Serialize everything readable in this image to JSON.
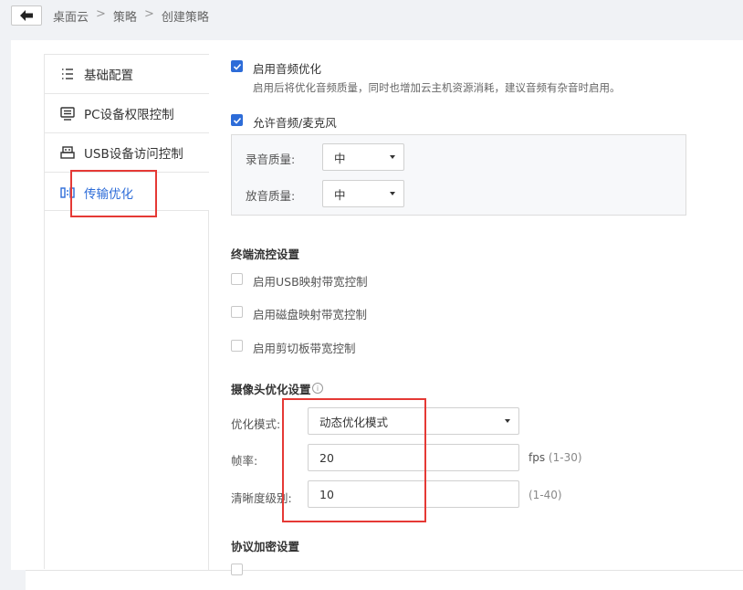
{
  "breadcrumb": {
    "items": [
      "桌面云",
      "策略",
      "创建策略"
    ],
    "separator": ">"
  },
  "sidebar": {
    "items": [
      {
        "label": "基础配置",
        "icon": "list-icon",
        "active": false
      },
      {
        "label": "PC设备权限控制",
        "icon": "monitor-icon",
        "active": false
      },
      {
        "label": "USB设备访问控制",
        "icon": "usb-icon",
        "active": false
      },
      {
        "label": "传输优化",
        "icon": "transfer-icon",
        "active": true
      }
    ]
  },
  "audio": {
    "enable_opt_label": "启用音频优化",
    "enable_opt_checked": true,
    "enable_opt_desc": "启用后将优化音频质量，同时也增加云主机资源消耗，建议音频有杂音时启用。",
    "allow_mic_label": "允许音频/麦克风",
    "allow_mic_checked": true,
    "record_quality_label": "录音质量:",
    "record_quality_value": "中",
    "playback_quality_label": "放音质量:",
    "playback_quality_value": "中"
  },
  "flow_control": {
    "title": "终端流控设置",
    "items": [
      {
        "label": "启用USB映射带宽控制",
        "checked": false
      },
      {
        "label": "启用磁盘映射带宽控制",
        "checked": false
      },
      {
        "label": "启用剪切板带宽控制",
        "checked": false
      }
    ]
  },
  "camera": {
    "title": "摄像头优化设置",
    "mode_label": "优化模式:",
    "mode_value": "动态优化模式",
    "fps_label": "帧率:",
    "fps_value": "20",
    "fps_unit": "fps",
    "fps_range": "(1-30)",
    "clarity_label": "清晰度级别:",
    "clarity_value": "10",
    "clarity_range": "(1-40)"
  },
  "encryption": {
    "title": "协议加密设置"
  },
  "colors": {
    "accent": "#2d6cd8",
    "highlight": "#e53935"
  }
}
